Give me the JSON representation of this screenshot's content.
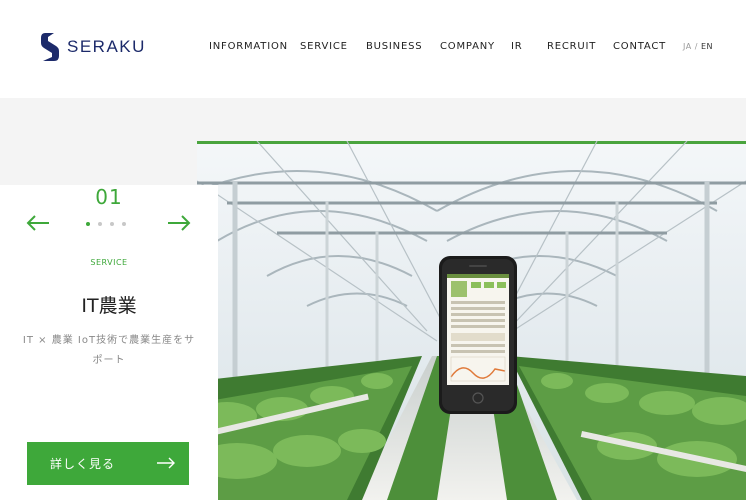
{
  "header": {
    "logo_text": "SERAKU",
    "nav": [
      {
        "label": "INFORMATION"
      },
      {
        "label": "SERVICE"
      },
      {
        "label": "BUSINESS"
      },
      {
        "label": "COMPANY"
      },
      {
        "label": "IR"
      },
      {
        "label": "RECRUIT"
      },
      {
        "label": "CONTACT"
      }
    ],
    "lang": {
      "ja": "JA",
      "separator": "/",
      "en": "EN"
    }
  },
  "slider": {
    "slide_number": "01",
    "total_dots": 4,
    "active_dot": 1,
    "category": "SERVICE",
    "title": "IT農業",
    "description": "IT × 農業 IoT技術で農業生産をサポート",
    "cta_label": "詳しく見る"
  },
  "colors": {
    "accent": "#3ea83a",
    "logo": "#1c2a6a",
    "header_bg": "#ffffff",
    "page_bg": "#f4f4f4"
  },
  "icons": {
    "prev": "arrow-left-icon",
    "next": "arrow-right-icon",
    "cta": "arrow-right-icon",
    "logo": "seraku-s-logo-icon"
  }
}
